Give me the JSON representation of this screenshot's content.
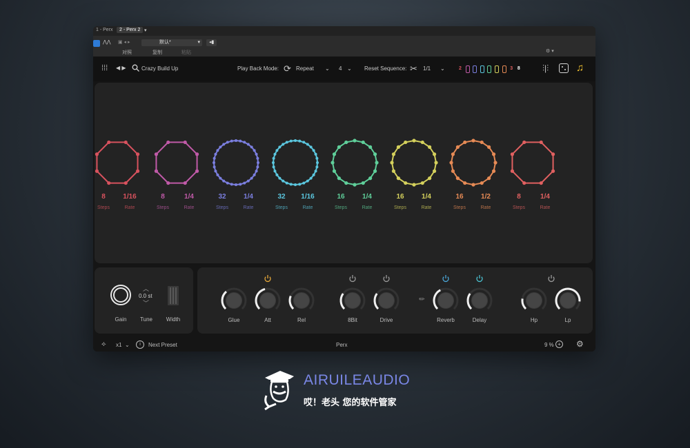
{
  "host": {
    "tab_inactive": "1 - Perx",
    "tab_active": "2 - Perx 2",
    "preset_label": "默认*",
    "btn_compare": "对照",
    "btn_copy": "复制",
    "btn_paste": "粘贴"
  },
  "toolbar": {
    "preset_name": "Crazy Build Up",
    "playback_label": "Play Back Mode:",
    "playback_value": "Repeat",
    "count_value": "4",
    "reset_label": "Reset Sequence:",
    "reset_value": "1/1",
    "color_chips": [
      {
        "label": "2",
        "color": "#d8525e"
      },
      {
        "color": "#c05aa8"
      },
      {
        "color": "#7b7fe0"
      },
      {
        "color": "#5bc7df"
      },
      {
        "color": "#5fcf9a"
      },
      {
        "color": "#d4d05c"
      },
      {
        "color": "#e68a55"
      },
      {
        "label": "3",
        "color": "#e06060"
      },
      {
        "label": "8",
        "color": "#ffffff"
      }
    ]
  },
  "sequencers": [
    {
      "steps": "8",
      "rate": "1/16",
      "color": "#d8525e",
      "points": 8,
      "steps_label": "Steps",
      "rate_label": "Rate"
    },
    {
      "steps": "8",
      "rate": "1/4",
      "color": "#c05aa8",
      "points": 8,
      "steps_label": "Steps",
      "rate_label": "Rate"
    },
    {
      "steps": "32",
      "rate": "1/4",
      "color": "#7b7fe0",
      "points": 32,
      "steps_label": "Steps",
      "rate_label": "Rate"
    },
    {
      "steps": "32",
      "rate": "1/16",
      "color": "#5bc7df",
      "points": 32,
      "steps_label": "Steps",
      "rate_label": "Rate"
    },
    {
      "steps": "16",
      "rate": "1/4",
      "color": "#5fcf9a",
      "points": 16,
      "steps_label": "Steps",
      "rate_label": "Rate"
    },
    {
      "steps": "16",
      "rate": "1/4",
      "color": "#d4d05c",
      "points": 16,
      "steps_label": "Steps",
      "rate_label": "Rate"
    },
    {
      "steps": "16",
      "rate": "1/2",
      "color": "#e68a55",
      "points": 16,
      "steps_label": "Steps",
      "rate_label": "Rate"
    },
    {
      "steps": "8",
      "rate": "1/4",
      "color": "#e06060",
      "points": 8,
      "steps_label": "Steps",
      "rate_label": "Rate"
    }
  ],
  "left_controls": {
    "gain_label": "Gain",
    "tune_label": "Tune",
    "tune_value": "0.0 st",
    "width_label": "Width"
  },
  "effects": [
    {
      "label": "Glue"
    },
    {
      "label": "Att"
    },
    {
      "label": "Rel"
    },
    {
      "label": "8Bit"
    },
    {
      "label": "Drive"
    },
    {
      "label": "Reverb"
    },
    {
      "label": "Delay"
    },
    {
      "label": "Hp"
    },
    {
      "label": "Lp"
    }
  ],
  "status": {
    "speed_value": "x1",
    "next_preset": "Next Preset",
    "plugin_name": "Perx",
    "zoom_value": "9 %"
  },
  "brand": {
    "name": "AIRUILEAUDIO",
    "tagline": "哎！老头 您的软件管家"
  }
}
